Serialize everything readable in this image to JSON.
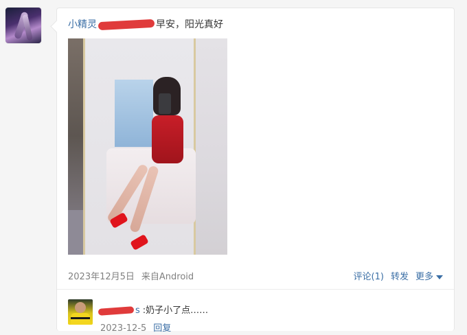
{
  "post": {
    "author_visible": "小精灵",
    "text": "早安，阳光真好",
    "date": "2023年12月5日",
    "source": "来自Android",
    "photo_icon": "post-photo"
  },
  "actions": {
    "comment_label": "评论(1)",
    "repost_label": "转发",
    "more_label": "更多"
  },
  "comment": {
    "user_visible": "s",
    "separator": ":",
    "text": "奶子小了点……",
    "date": "2023-12-5",
    "reply_label": "回复"
  },
  "colors": {
    "link": "#3a6ea5",
    "muted": "#808080",
    "redaction": "#e03b3b"
  }
}
